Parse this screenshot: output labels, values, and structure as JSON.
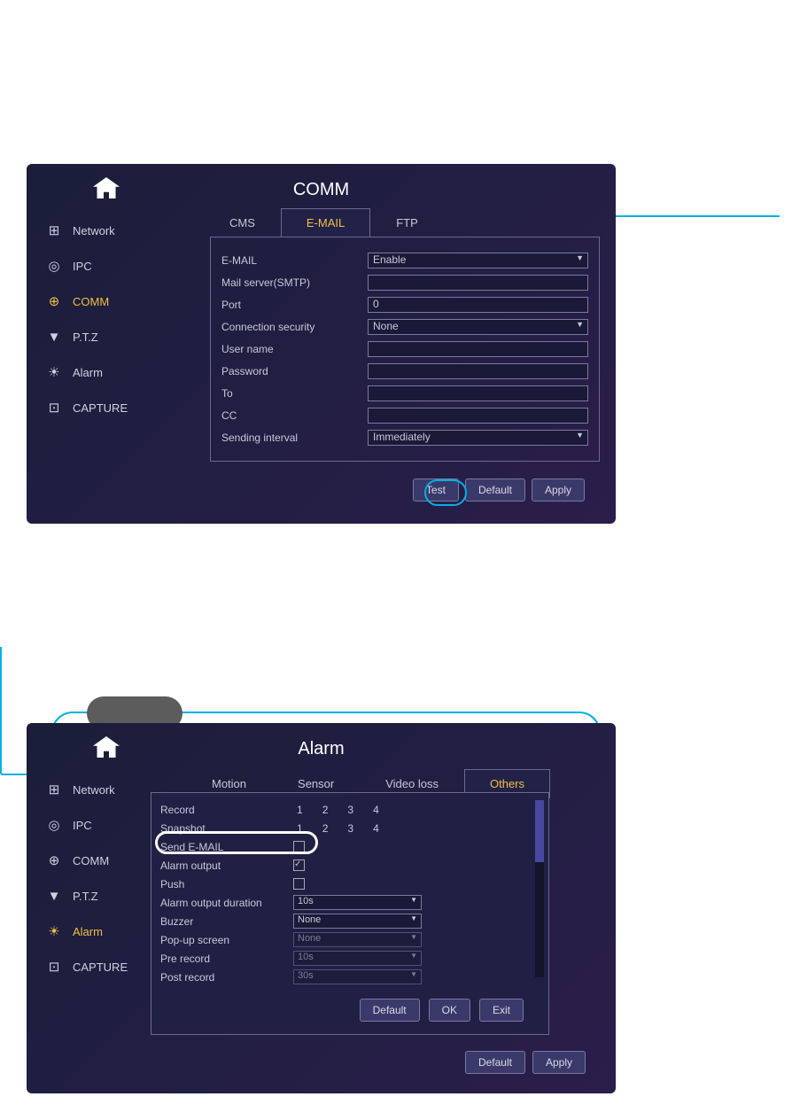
{
  "screen1": {
    "title": "COMM",
    "sidebar": [
      "Network",
      "IPC",
      "COMM",
      "P.T.Z",
      "Alarm",
      "CAPTURE"
    ],
    "activeSide": "COMM",
    "tabs": [
      "CMS",
      "E-MAIL",
      "FTP"
    ],
    "activeTab": "E-MAIL",
    "fields": {
      "email_label": "E-MAIL",
      "email_val": "Enable",
      "smtp_label": "Mail server(SMTP)",
      "smtp_val": "",
      "port_label": "Port",
      "port_val": "0",
      "sec_label": "Connection security",
      "sec_val": "None",
      "user_label": "User name",
      "user_val": "",
      "pwd_label": "Password",
      "pwd_val": "",
      "to_label": "To",
      "to_val": "",
      "cc_label": "CC",
      "cc_val": "",
      "intv_label": "Sending interval",
      "intv_val": "Immediately"
    },
    "buttons": {
      "test": "Test",
      "default": "Default",
      "apply": "Apply"
    }
  },
  "screen2": {
    "title": "Alarm",
    "sidebar": [
      "Network",
      "IPC",
      "COMM",
      "P.T.Z",
      "Alarm",
      "CAPTURE"
    ],
    "activeSide": "Alarm",
    "tabs": [
      "Motion",
      "Sensor",
      "Video loss",
      "Others"
    ],
    "activeTab": "Others",
    "rows": {
      "record": "Record",
      "record_vals": [
        "1",
        "2",
        "3",
        "4"
      ],
      "snap": "Snapshot",
      "snap_vals": [
        "1",
        "2",
        "3",
        "4"
      ],
      "email": "Send E-MAIL",
      "alarm_out": "Alarm output",
      "push": "Push",
      "aodur": "Alarm output duration",
      "aodur_val": "10s",
      "buzzer": "Buzzer",
      "buzzer_val": "None",
      "popup": "Pop-up screen",
      "popup_val": "None",
      "pre": "Pre record",
      "pre_val": "10s",
      "post": "Post record",
      "post_val": "30s"
    },
    "inner_buttons": {
      "default": "Default",
      "ok": "OK",
      "exit": "Exit"
    },
    "outer_buttons": {
      "default": "Default",
      "apply": "Apply"
    }
  }
}
